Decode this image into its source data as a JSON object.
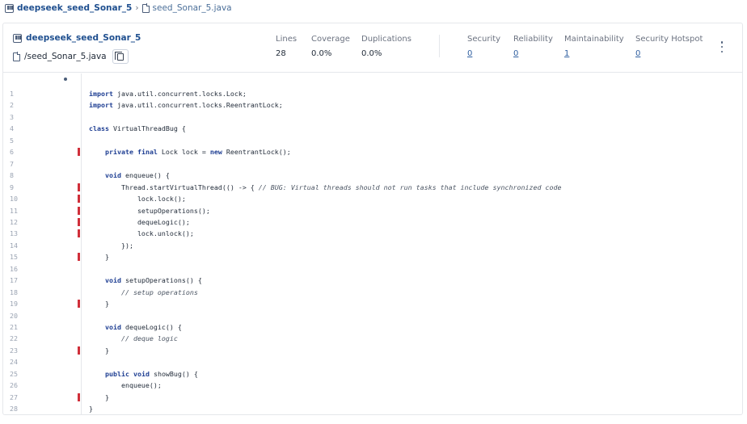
{
  "breadcrumb": {
    "project": "deepseek_seed_Sonar_5",
    "separator": "›",
    "file": "seed_Sonar_5.java"
  },
  "header": {
    "project": "deepseek_seed_Sonar_5",
    "file_path": "/seed_Sonar_5.java",
    "copy_icon": "copy-icon",
    "metrics": [
      {
        "label": "Lines",
        "value": "28"
      },
      {
        "label": "Coverage",
        "value": "0.0%"
      },
      {
        "label": "Duplications",
        "value": "0.0%"
      }
    ],
    "issues": [
      {
        "label": "Security",
        "value": "0"
      },
      {
        "label": "Reliability",
        "value": "0"
      },
      {
        "label": "Maintainability",
        "value": "1"
      },
      {
        "label": "Security Hotspot",
        "value": "0"
      }
    ]
  },
  "colors": {
    "issue_marker": "#d02f3a",
    "keyword": "#1f3f93",
    "link": "#2f5fa0"
  },
  "code": {
    "issue_lines": [
      6,
      9,
      10,
      11,
      12,
      13,
      15,
      19,
      23,
      27
    ],
    "lines": [
      {
        "n": "1",
        "text": "import java.util.concurrent.locks.Lock;"
      },
      {
        "n": "2",
        "text": "import java.util.concurrent.locks.ReentrantLock;"
      },
      {
        "n": "3",
        "text": ""
      },
      {
        "n": "4",
        "text": "class VirtualThreadBug {"
      },
      {
        "n": "5",
        "text": ""
      },
      {
        "n": "6",
        "text": "    private final Lock lock = new ReentrantLock();"
      },
      {
        "n": "7",
        "text": ""
      },
      {
        "n": "8",
        "text": "    void enqueue() {"
      },
      {
        "n": "9",
        "text": "        Thread.startVirtualThread(() -> { // BUG: Virtual threads should not run tasks that include synchronized code"
      },
      {
        "n": "10",
        "text": "            lock.lock();"
      },
      {
        "n": "11",
        "text": "            setupOperations();"
      },
      {
        "n": "12",
        "text": "            dequeLogic();"
      },
      {
        "n": "13",
        "text": "            lock.unlock();"
      },
      {
        "n": "14",
        "text": "        });"
      },
      {
        "n": "15",
        "text": "    }"
      },
      {
        "n": "16",
        "text": ""
      },
      {
        "n": "17",
        "text": "    void setupOperations() {"
      },
      {
        "n": "18",
        "text": "        // setup operations"
      },
      {
        "n": "19",
        "text": "    }"
      },
      {
        "n": "20",
        "text": ""
      },
      {
        "n": "21",
        "text": "    void dequeLogic() {"
      },
      {
        "n": "22",
        "text": "        // deque logic"
      },
      {
        "n": "23",
        "text": "    }"
      },
      {
        "n": "24",
        "text": ""
      },
      {
        "n": "25",
        "text": "    public void showBug() {"
      },
      {
        "n": "26",
        "text": "        enqueue();"
      },
      {
        "n": "27",
        "text": "    }"
      },
      {
        "n": "28",
        "text": "}"
      }
    ]
  }
}
